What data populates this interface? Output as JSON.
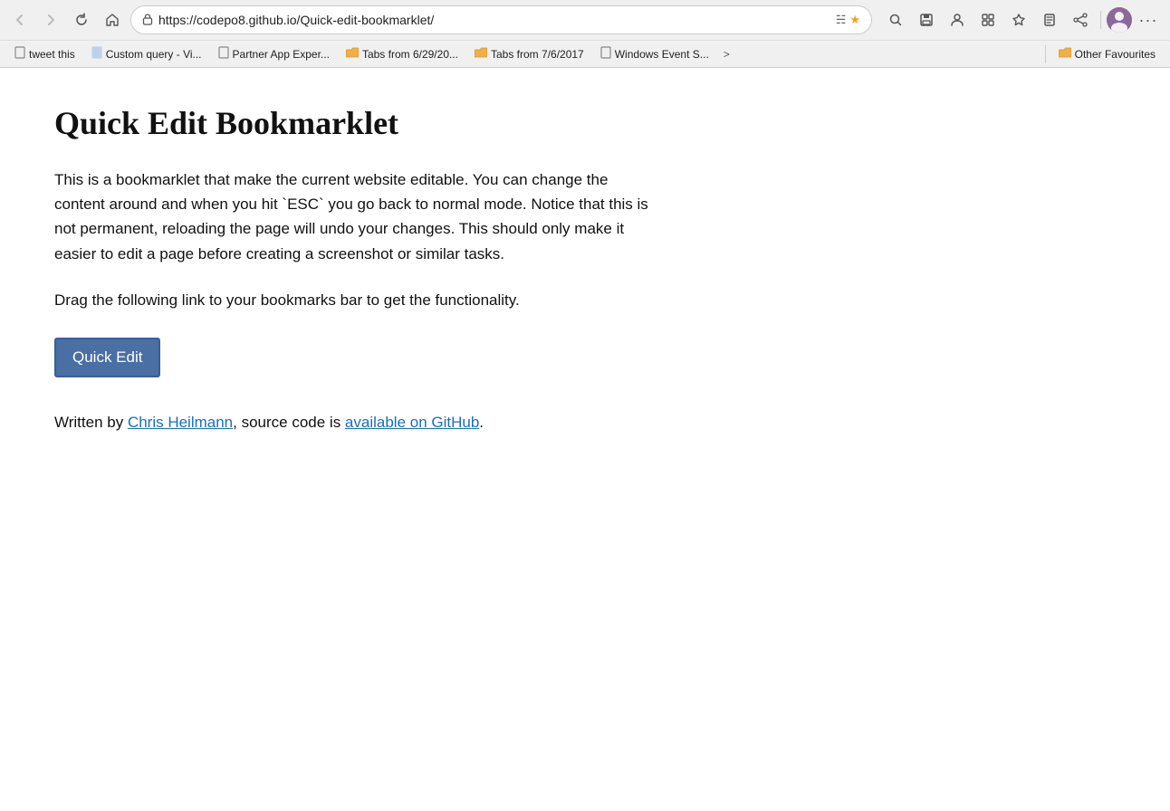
{
  "browser": {
    "url": "https://codepo8.github.io/Quick-edit-bookmarklet/",
    "back_tooltip": "Back",
    "forward_tooltip": "Forward",
    "refresh_tooltip": "Refresh",
    "home_tooltip": "Home"
  },
  "bookmarks": {
    "items": [
      {
        "label": "tweet this",
        "type": "file"
      },
      {
        "label": "Custom query - Vi...",
        "type": "file",
        "color": "blue"
      },
      {
        "label": "Partner App Exper...",
        "type": "file"
      },
      {
        "label": "Tabs from 6/29/20...",
        "type": "folder",
        "color": "orange"
      },
      {
        "label": "Tabs from 7/6/2017",
        "type": "folder",
        "color": "orange"
      },
      {
        "label": "Windows Event S...",
        "type": "file"
      }
    ],
    "overflow_label": ">",
    "other_favourites_label": "Other Favourites"
  },
  "page": {
    "title": "Quick Edit Bookmarklet",
    "description": "This is a bookmarklet that make the current website editable. You can change the content around and when you hit `ESC` you go back to normal mode. Notice that this is not permanent, reloading the page will undo your changes. This should only make it easier to edit a page before creating a screenshot or similar tasks.",
    "drag_instruction": "Drag the following link to your bookmarks bar to get the functionality.",
    "quick_edit_label": "Quick Edit",
    "attribution_prefix": "Written by ",
    "attribution_author": "Chris Heilmann",
    "attribution_middle": ", source code is ",
    "attribution_link": "available on GitHub",
    "attribution_suffix": "."
  }
}
